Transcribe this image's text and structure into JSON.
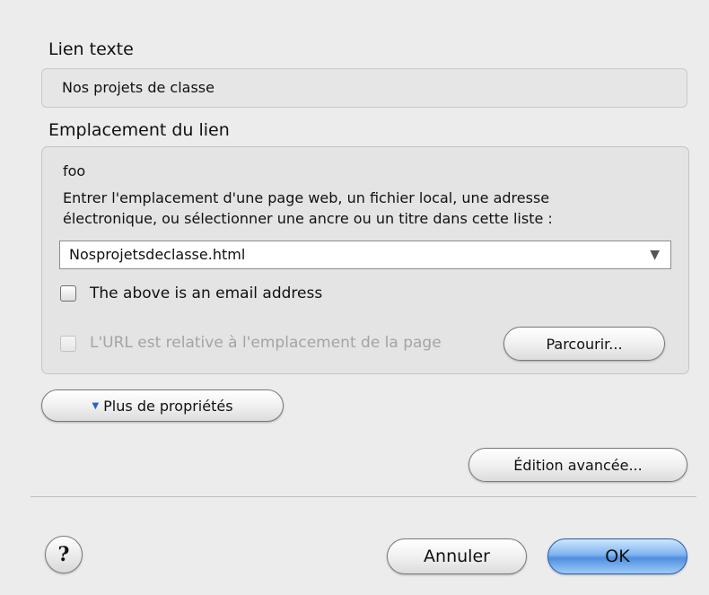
{
  "link_text": {
    "label": "Lien texte",
    "value": "Nos projets de classe"
  },
  "location": {
    "label": "Emplacement du lien",
    "current": "foo",
    "instructions_line1": "Entrer l'emplacement d'une page web, un fichier local, une adresse",
    "instructions_line2": "électronique, ou sélectionner une ancre ou un titre dans cette liste :",
    "combo_value": "Nosprojetsdeclasse.html",
    "combo_arrow": "▼",
    "email_checkbox": {
      "label": "The above is an email address",
      "checked": false
    },
    "relative_checkbox": {
      "label": "L'URL est relative à l'emplacement de la page",
      "checked": false,
      "enabled": false
    },
    "browse_button": "Parcourir..."
  },
  "more_properties_button": "Plus de propriétés",
  "more_properties_icon": "▼",
  "advanced_edit_button": "Édition avancée...",
  "footer": {
    "help_button": "?",
    "cancel_button": "Annuler",
    "ok_button": "OK"
  }
}
